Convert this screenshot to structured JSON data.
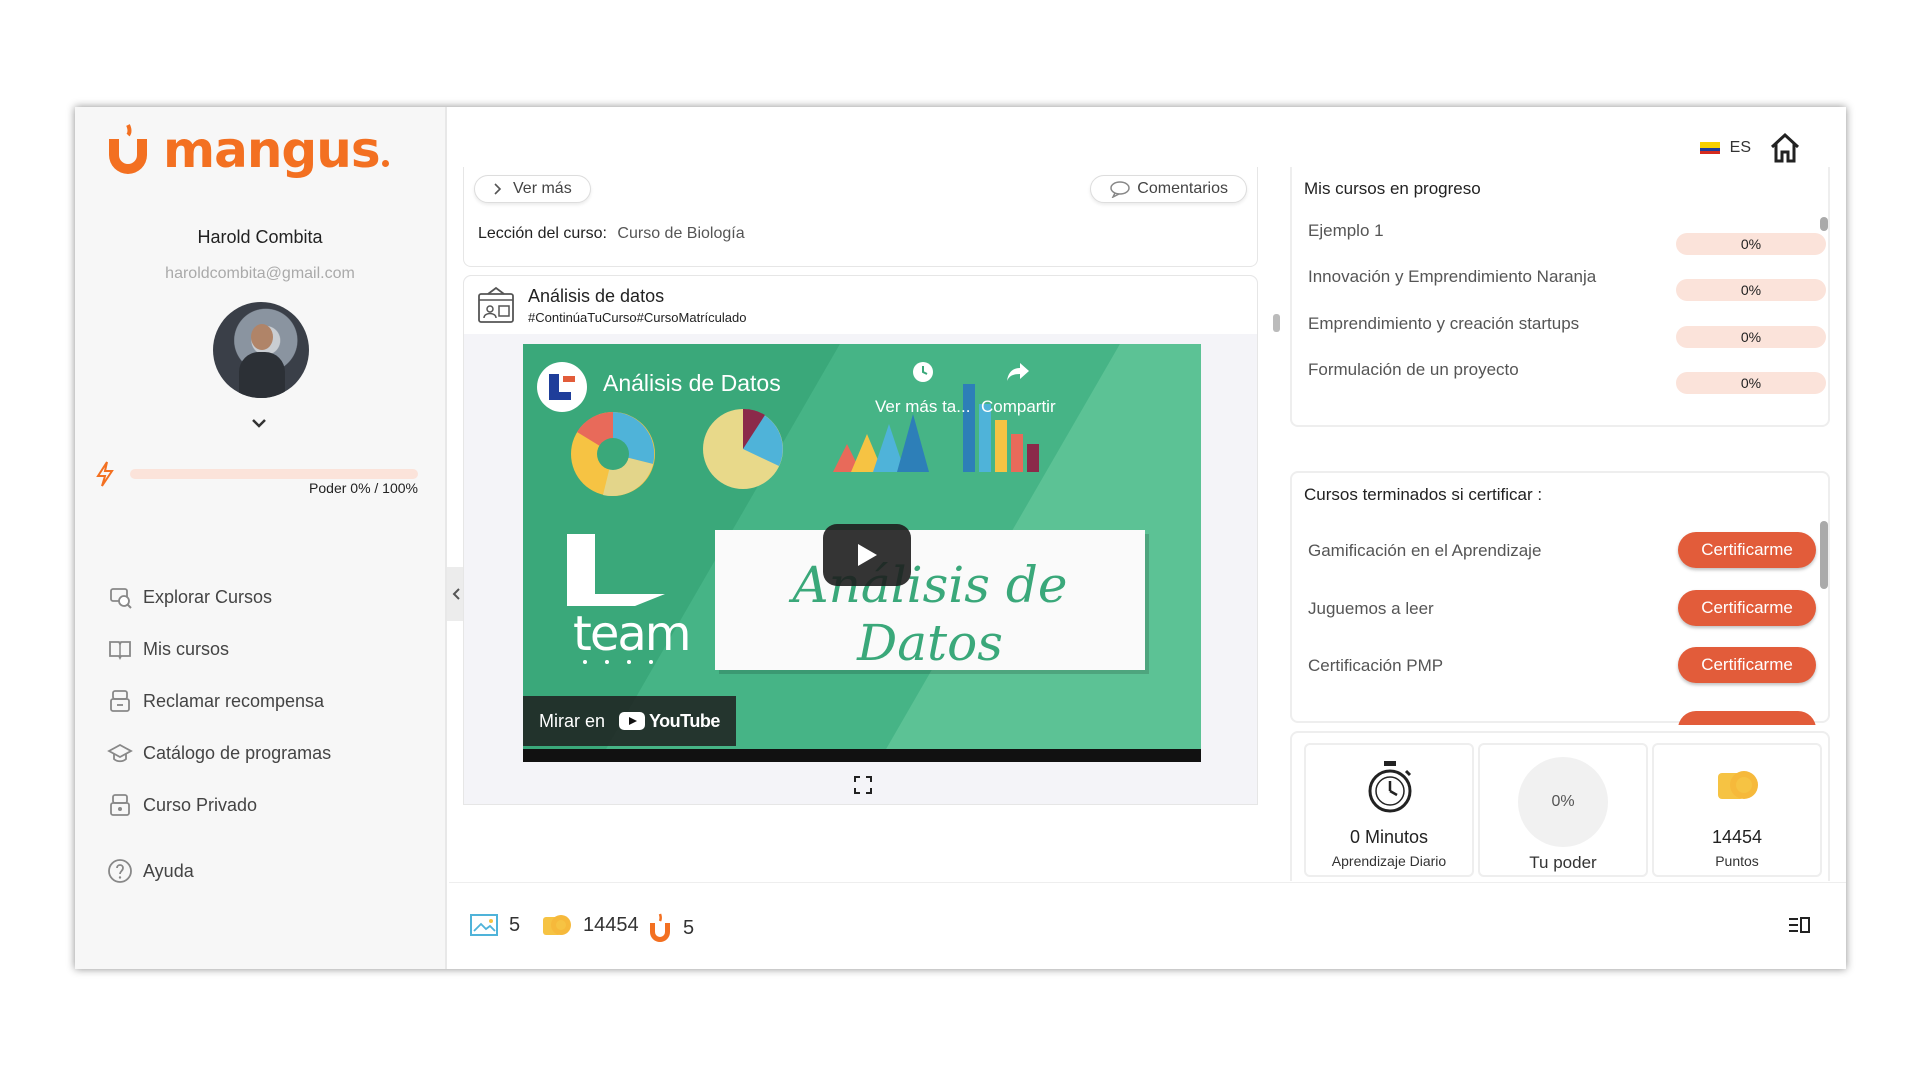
{
  "brand": {
    "name": "mangus",
    "color": "#f37021"
  },
  "user": {
    "name": "Harold Combita",
    "email": "haroldcombita@gmail.com"
  },
  "power": {
    "label": "Poder 0% / 100%",
    "percent": 0
  },
  "nav": [
    {
      "label": "Explorar Cursos",
      "icon": "explore-courses-icon"
    },
    {
      "label": "Mis cursos",
      "icon": "book-icon"
    },
    {
      "label": "Reclamar recompensa",
      "icon": "reward-icon"
    },
    {
      "label": "Catálogo de programas",
      "icon": "graduation-cap-icon"
    },
    {
      "label": "Curso Privado",
      "icon": "private-course-icon"
    },
    {
      "label": "Ayuda",
      "icon": "help-icon"
    }
  ],
  "topbar": {
    "language": "ES"
  },
  "post": {
    "see_more": "Ver más",
    "comments": "Comentarios",
    "lesson_label": "Lección del curso:",
    "lesson_value": "Curso de Biología"
  },
  "video_card": {
    "title": "Análisis de datos",
    "tags": "#ContinúaTuCurso#CursoMatrículado",
    "video_title": "Análisis de Datos",
    "watch_later": "Ver más ta...",
    "share": "Compartir",
    "board_text": "Análisis de Datos",
    "team_text": "team",
    "watch_on": "Mirar en",
    "youtube": "YouTube"
  },
  "progress_panel": {
    "title": "Mis cursos en progreso",
    "courses": [
      {
        "name": "Ejemplo 1",
        "percent": "0%"
      },
      {
        "name": "Innovación y Emprendimiento Naranja",
        "percent": "0%"
      },
      {
        "name": "Emprendimiento y creación startups",
        "percent": "0%"
      },
      {
        "name": "Formulación de un proyecto",
        "percent": "0%"
      }
    ]
  },
  "certify_panel": {
    "title": "Cursos terminados si certificar :",
    "courses": [
      {
        "name": "Gamificación en el Aprendizaje",
        "button": "Certificarme"
      },
      {
        "name": "Juguemos a leer",
        "button": "Certificarme"
      },
      {
        "name": "Certificación PMP",
        "button": "Certificarme"
      }
    ]
  },
  "stats": [
    {
      "value": "0 Minutos",
      "label": "Aprendizaje Diario",
      "icon": "stopwatch-icon"
    },
    {
      "value": "0%",
      "label": "Tu poder",
      "icon": "power-circle-icon"
    },
    {
      "value": "14454",
      "label": "Puntos",
      "icon": "coins-icon"
    }
  ],
  "bottom_bar": {
    "images": "5",
    "coins": "14454",
    "fruits": "5"
  },
  "colors": {
    "accent": "#f37021",
    "button": "#e25c3a",
    "progress_bg": "#fbe3da"
  }
}
